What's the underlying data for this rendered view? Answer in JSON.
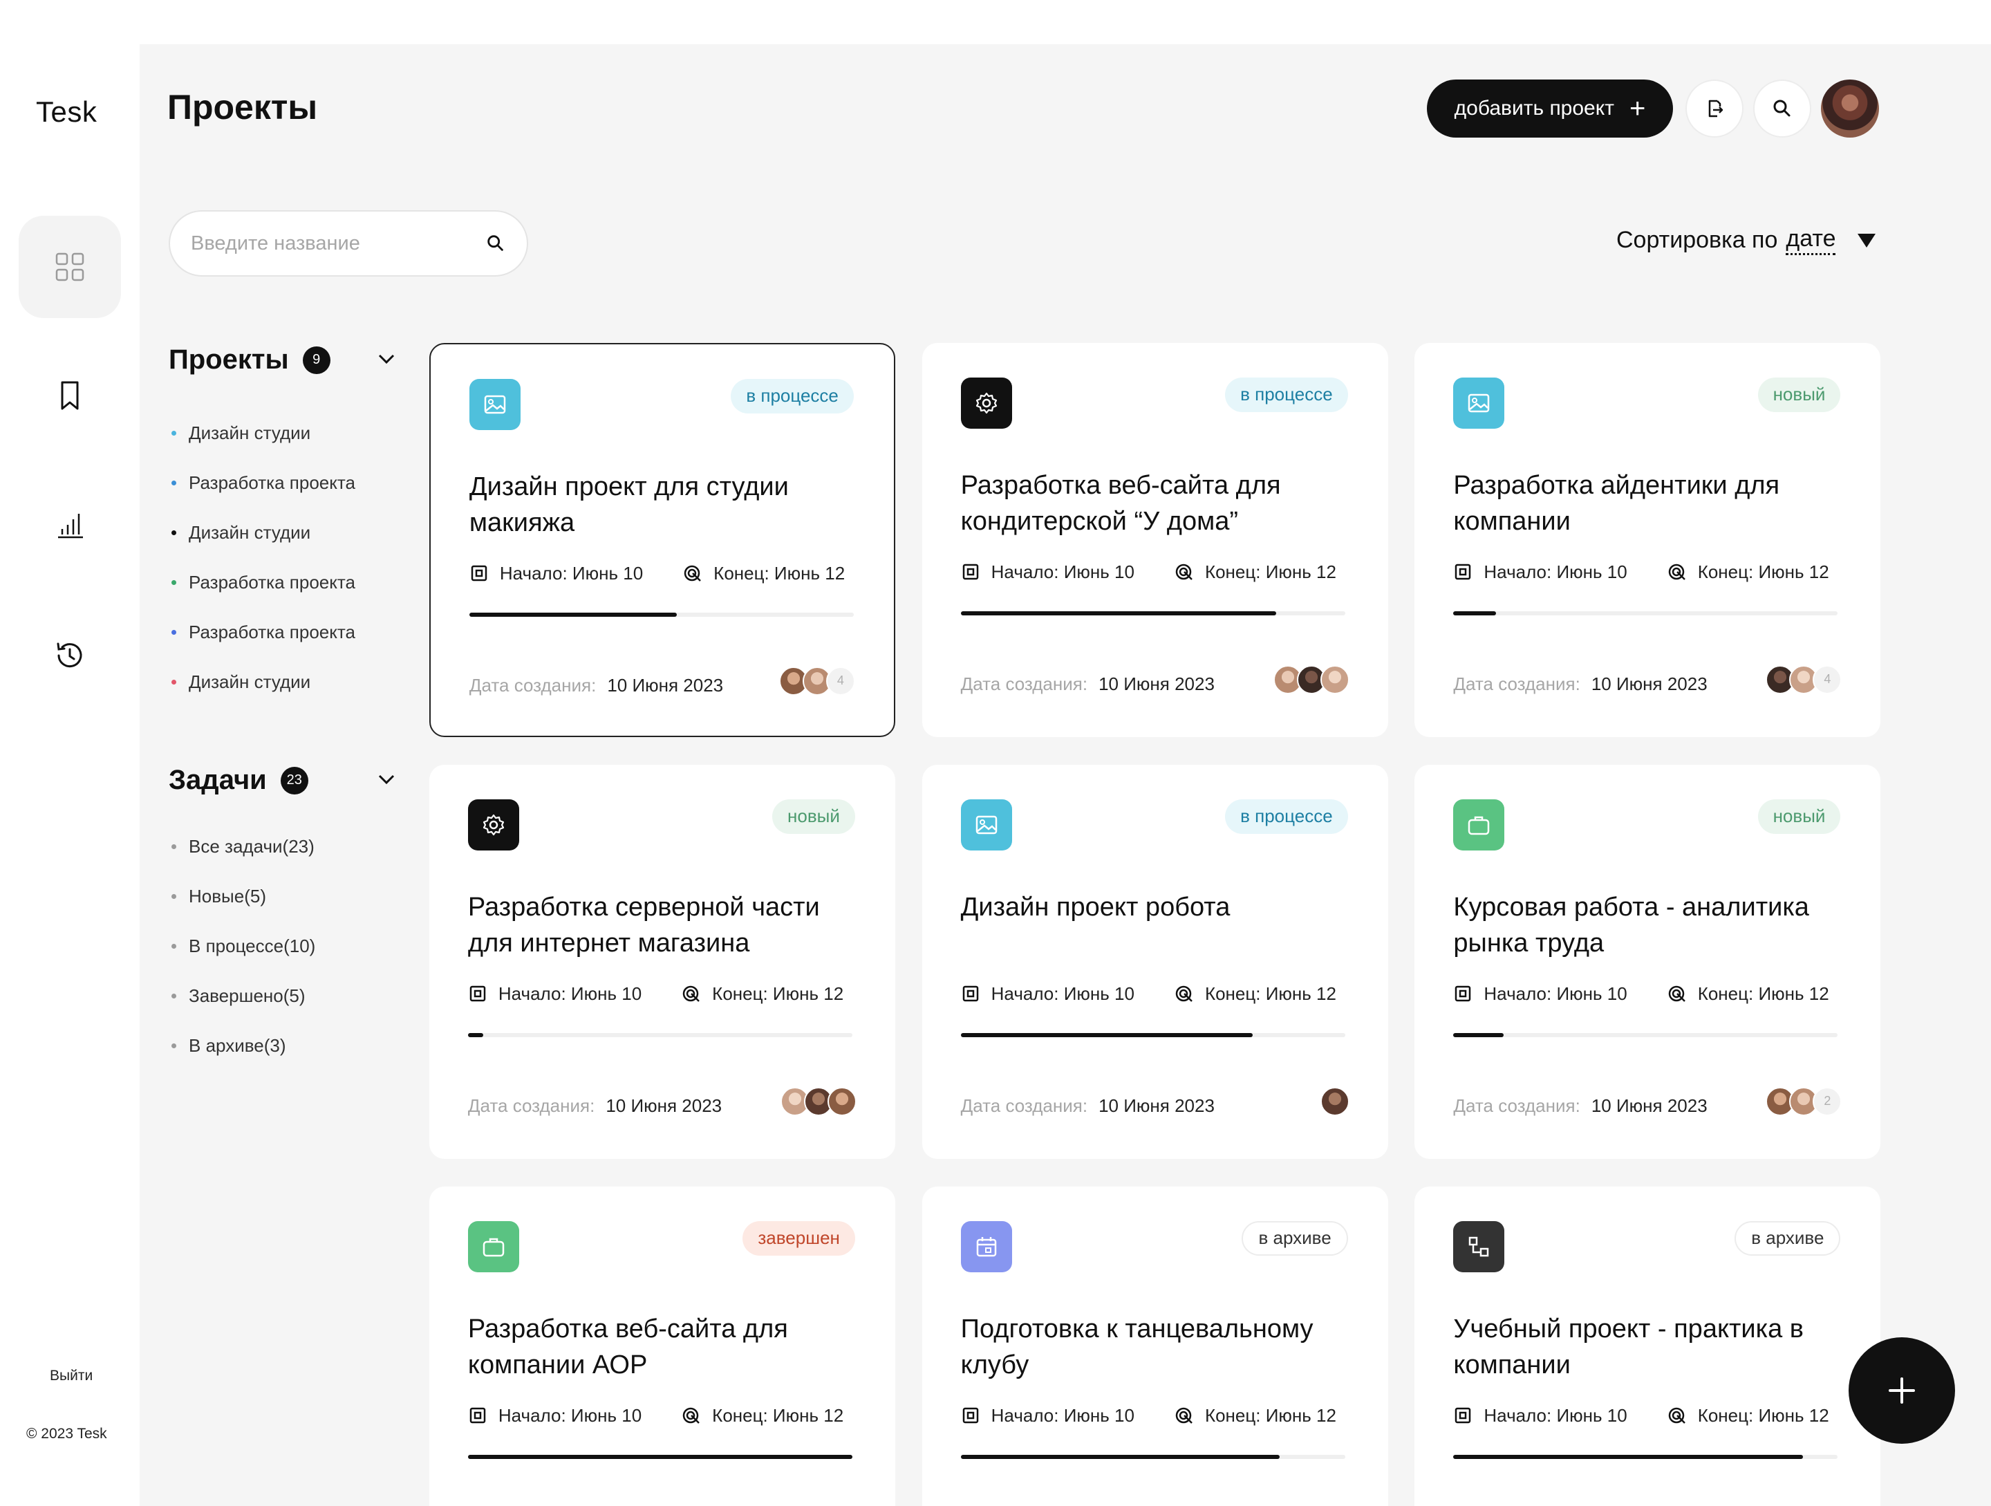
{
  "app": {
    "logo": "Tesk",
    "logout": "Выйти",
    "copyright": "© 2023 Tesk"
  },
  "header": {
    "title": "Проекты",
    "add_button": "добавить проект",
    "icons": [
      "logout-icon",
      "search-icon"
    ]
  },
  "search": {
    "placeholder": "Введите название",
    "value": ""
  },
  "sort": {
    "label": "Сортировка по",
    "value": "дате"
  },
  "projects_section": {
    "title": "Проекты",
    "count": "9",
    "items": [
      {
        "label": "Дизайн студии",
        "color": "#4ab4de"
      },
      {
        "label": "Разработка проекта",
        "color": "#3b8fd6"
      },
      {
        "label": "Дизайн студии",
        "color": "#111111"
      },
      {
        "label": "Разработка проекта",
        "color": "#3aa86b"
      },
      {
        "label": "Разработка проекта",
        "color": "#4a6fe0"
      },
      {
        "label": "Дизайн студии",
        "color": "#e2566a"
      }
    ]
  },
  "tasks_section": {
    "title": "Задачи",
    "count": "23",
    "items": [
      {
        "label": "Все задачи(23)",
        "color": "#9a9a9a"
      },
      {
        "label": "Новые(5)",
        "color": "#9a9a9a"
      },
      {
        "label": "В процессе(10)",
        "color": "#9a9a9a"
      },
      {
        "label": "Завершено(5)",
        "color": "#9a9a9a"
      },
      {
        "label": "В архиве(3)",
        "color": "#9a9a9a"
      }
    ]
  },
  "card_labels": {
    "start": "Начало: Июнь 10",
    "end": "Конец: Июнь 12",
    "created_label": "Дата создания:"
  },
  "cards": [
    {
      "title": "Дизайн проект для студии макияжа",
      "status": "в процессе",
      "icon": "image-icon",
      "created": "10 Июня 2023",
      "progress": 0.54,
      "more": "4"
    },
    {
      "title": "Разработка веб-сайта для кондитерской “У дома”",
      "status": "в процессе",
      "icon": "gear-icon",
      "created": "10 Июня 2023",
      "progress": 0.82,
      "more": ""
    },
    {
      "title": "Разработка айдентики для компании",
      "status": "новый",
      "icon": "image-icon",
      "created": "10 Июня 2023",
      "progress": 0.11,
      "more": "4"
    },
    {
      "title": "Разработка серверной части для интернет магазина",
      "status": "новый",
      "icon": "gear-icon",
      "created": "10 Июня 2023",
      "progress": 0.04,
      "more": ""
    },
    {
      "title": "Дизайн проект робота",
      "status": "в процессе",
      "icon": "image-icon",
      "created": "10 Июня 2023",
      "progress": 0.76,
      "more": ""
    },
    {
      "title": "Курсовая работа - аналитика рынка труда",
      "status": "новый",
      "icon": "briefcase-icon",
      "created": "10 Июня 2023",
      "progress": 0.13,
      "more": "2"
    },
    {
      "title": "Разработка веб-сайта для компании АОР",
      "status": "завершен",
      "icon": "briefcase-icon",
      "created": "",
      "progress": 1.0,
      "more": ""
    },
    {
      "title": "Подготовка к танцевальному клубу",
      "status": "в архиве",
      "icon": "calendar-icon",
      "created": "",
      "progress": 0.83,
      "more": ""
    },
    {
      "title": "Учебный проект - практика в компании",
      "status": "в архиве",
      "icon": "diagram-icon",
      "created": "",
      "progress": 0.91,
      "more": ""
    }
  ],
  "colors": {
    "accent": "#111111",
    "icon_image_bg": "#4fc0dc",
    "icon_gear_bg": "#111111",
    "icon_briefcase_bg": "#5ac382",
    "icon_calendar_bg": "#8796f0",
    "icon_diagram_bg": "#333333",
    "badge_process_bg": "#e6f6fa",
    "badge_process_fg": "#1d7fa3",
    "badge_new_bg": "#eaf5ee",
    "badge_new_fg": "#4c9a6e",
    "badge_done_bg": "#fde9e3",
    "badge_done_fg": "#c0462a",
    "badge_archive_bg": "#ffffff",
    "badge_archive_fg": "#333333"
  }
}
